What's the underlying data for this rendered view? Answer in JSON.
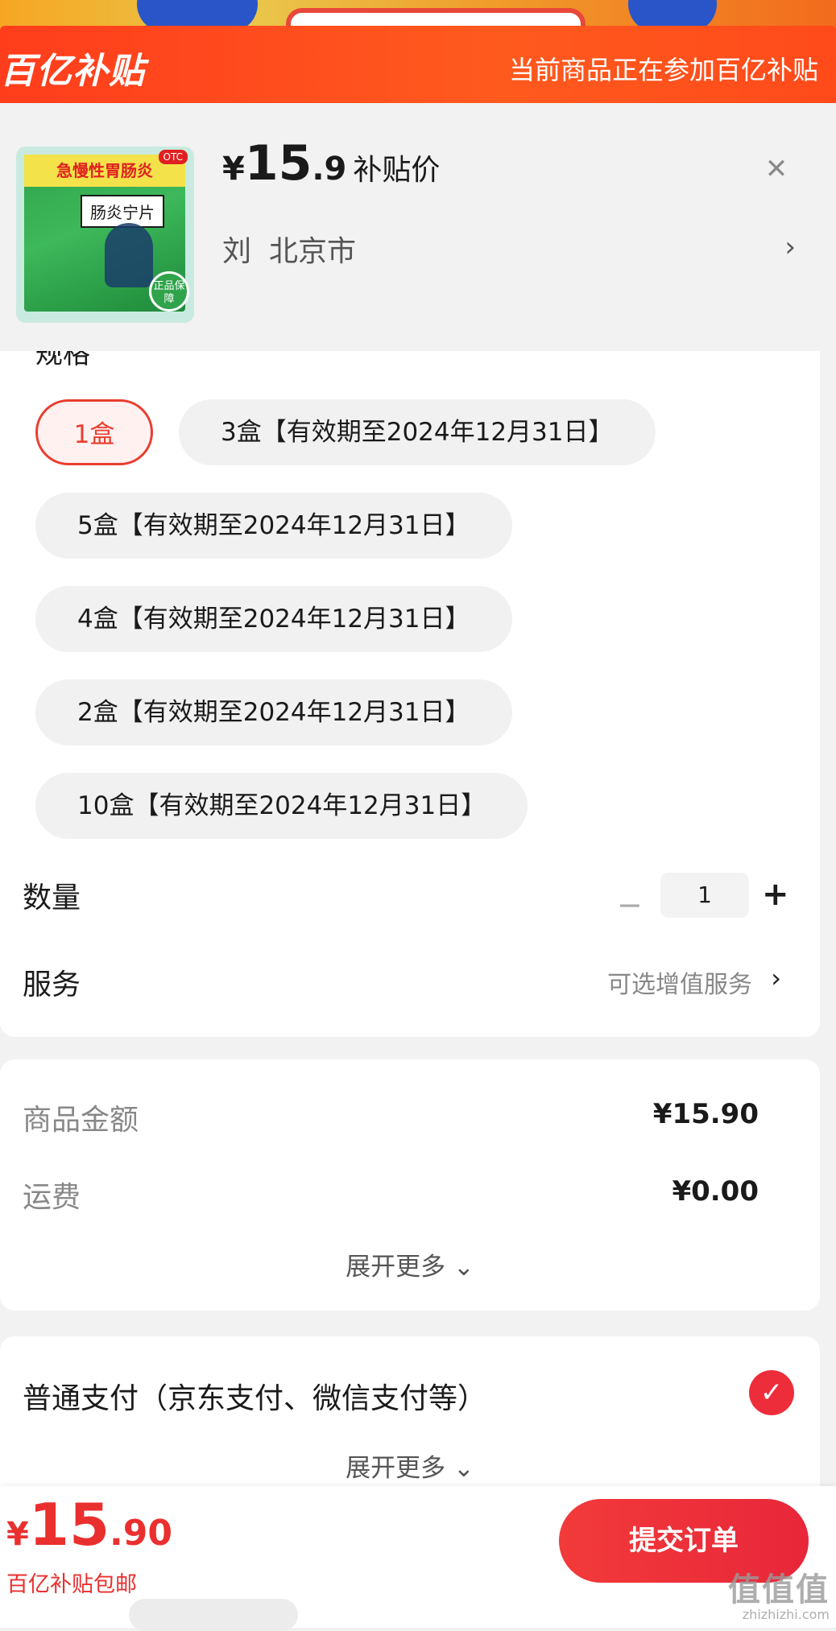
{
  "banner": {
    "logo": "百亿补贴",
    "notice": "当前商品正在参加百亿补贴"
  },
  "product": {
    "image": {
      "top_text": "急慢性胃肠炎",
      "otc": "OTC",
      "name": "肠炎宁片",
      "seal": "正品保障"
    },
    "price": {
      "currency": "¥",
      "integer": "15",
      "decimal": ".9",
      "tag": "补贴价"
    },
    "recipient": "刘",
    "city": "北京市"
  },
  "spec": {
    "label": "规格",
    "options": [
      {
        "label": "1盒",
        "selected": true
      },
      {
        "label": "3盒【有效期至2024年12月31日】"
      },
      {
        "label": "5盒【有效期至2024年12月31日】"
      },
      {
        "label": "4盒【有效期至2024年12月31日】"
      },
      {
        "label": "2盒【有效期至2024年12月31日】"
      },
      {
        "label": "10盒【有效期至2024年12月31日】"
      }
    ]
  },
  "quantity": {
    "label": "数量",
    "value": "1",
    "minus": "−",
    "plus": "+"
  },
  "service": {
    "label": "服务",
    "hint": "可选增值服务"
  },
  "fees": {
    "goods_label": "商品金额",
    "goods_value": "¥15.90",
    "shipping_label": "运费",
    "shipping_value": "¥0.00",
    "expand": "展开更多 ⌄"
  },
  "payment": {
    "label": "普通支付（京东支付、微信支付等）",
    "expand": "展开更多 ⌄"
  },
  "bottom": {
    "currency": "¥",
    "integer": "15",
    "decimal": ".90",
    "note": "百亿补贴包邮",
    "submit": "提交订单"
  },
  "watermark": {
    "line1": "值值值",
    "line2": "zhizhizhi.com"
  },
  "icons": {
    "close": "close-icon",
    "chevron": "chevron-right-icon",
    "check": "check-icon"
  },
  "colors": {
    "brand": "#ff4a1a",
    "accent": "#ea3d2f"
  }
}
